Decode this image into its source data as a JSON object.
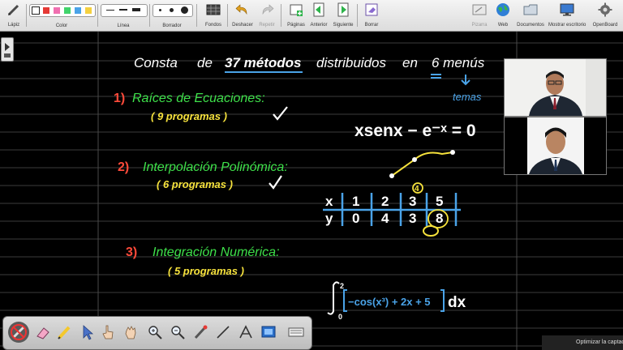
{
  "toolbar": {
    "lapiz": "Lápiz",
    "color": "Color",
    "linea": "Línea",
    "borrador": "Borrador",
    "fondos": "Fondos",
    "deshacer": "Deshacer",
    "repetir": "Repetir",
    "paginas": "Páginas",
    "anterior": "Anterior",
    "siguiente": "Siguiente",
    "borrar": "Borrar",
    "pizarra": "Pizarra",
    "web": "Web",
    "documentos": "Documentos",
    "mostrar_escritorio": "Mostrar escritorio",
    "openboard": "OpenBoard",
    "colors": [
      "#ffffff",
      "#e53935",
      "#f06fb0",
      "#41d36b",
      "#4aa3e8",
      "#f4d03f"
    ]
  },
  "board": {
    "heading": {
      "consta": "Consta",
      "de": "de",
      "count_methods": "37 métodos",
      "distribuidos": "distribuidos",
      "en": "en",
      "menus": "6 menús",
      "temas": "temas"
    },
    "section1": {
      "number": "1)",
      "title": "Raíces de Ecuaciones:",
      "programs": "( 9 programas )"
    },
    "equation1": "xsenx − e⁻ˣ = 0",
    "section2": {
      "number": "2)",
      "title": "Interpolación Polinómica:",
      "programs": "( 6 programas )"
    },
    "table": {
      "row_x": [
        "x",
        "1",
        "2",
        "3",
        "5"
      ],
      "row_y": [
        "y",
        "0",
        "4",
        "3",
        "8"
      ],
      "circled_top": "4"
    },
    "section3": {
      "number": "3)",
      "title": "Integración Numérica:",
      "programs": "( 5 programas )"
    },
    "integral": {
      "upper": "2",
      "lower": "0",
      "integrand": "−cos(x³) + 2x + 5",
      "dx": "dx"
    }
  },
  "notification": "Optimizar la captación"
}
